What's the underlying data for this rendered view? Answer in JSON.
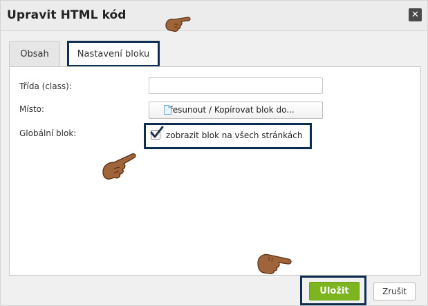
{
  "dialog": {
    "title": "Upravit HTML kód",
    "close_icon": "close-icon"
  },
  "tabs": [
    {
      "label": "Obsah",
      "active": false
    },
    {
      "label": "Nastavení bloku",
      "active": true
    }
  ],
  "form": {
    "class_label": "Třída (class):",
    "class_value": "",
    "location_label": "Místo:",
    "location_button_label": "Přesunout / Kopírovat blok do...",
    "location_icon": "document-icon",
    "global_label": "Globální blok:",
    "global_checkbox_label": "zobrazit blok na všech stránkách",
    "global_checked": true
  },
  "footer": {
    "save_label": "Uložit",
    "cancel_label": "Zrušit"
  },
  "colors": {
    "accent_green": "#7cb520",
    "highlight_frame": "#0e2d52",
    "pointer_hand": "#a0643a"
  },
  "annotations": {
    "pointer_icon": "pointing-hand-icon"
  }
}
